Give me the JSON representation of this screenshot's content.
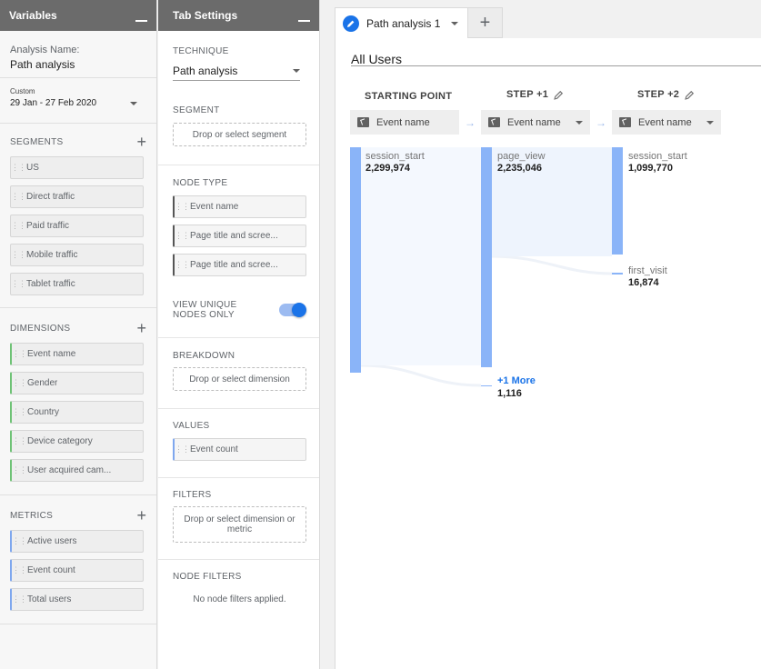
{
  "variables": {
    "title": "Variables",
    "analysis_name_label": "Analysis Name:",
    "analysis_name": "Path analysis",
    "date_preset": "Custom",
    "date_range": "29 Jan - 27 Feb 2020",
    "segments_title": "SEGMENTS",
    "segments": [
      "US",
      "Direct traffic",
      "Paid traffic",
      "Mobile traffic",
      "Tablet traffic"
    ],
    "dimensions_title": "DIMENSIONS",
    "dimensions": [
      "Event name",
      "Gender",
      "Country",
      "Device category",
      "User acquired cam..."
    ],
    "metrics_title": "METRICS",
    "metrics": [
      "Active users",
      "Event count",
      "Total users"
    ]
  },
  "settings": {
    "title": "Tab Settings",
    "technique_label": "TECHNIQUE",
    "technique_value": "Path analysis",
    "segment_label": "SEGMENT",
    "segment_drop": "Drop or select segment",
    "node_type_label": "NODE TYPE",
    "node_types": [
      "Event name",
      "Page title and scree...",
      "Page title and scree..."
    ],
    "unique_nodes_label": "VIEW UNIQUE NODES ONLY",
    "breakdown_label": "BREAKDOWN",
    "breakdown_drop": "Drop or select dimension",
    "values_label": "VALUES",
    "values_item": "Event count",
    "filters_label": "FILTERS",
    "filters_drop": "Drop or select dimension or metric",
    "node_filters_label": "NODE FILTERS",
    "node_filters_text": "No node filters applied."
  },
  "canvas": {
    "tab_label": "Path analysis 1",
    "add_tab": "+",
    "segment_title": "All Users",
    "columns": [
      {
        "header": "STARTING POINT",
        "node_type": "Event name"
      },
      {
        "header": "STEP +1",
        "node_type": "Event name"
      },
      {
        "header": "STEP +2",
        "node_type": "Event name"
      }
    ],
    "arrow": "→",
    "nodes": {
      "start_label": "session_start",
      "start_value": "2,299,974",
      "step1_label": "page_view",
      "step1_value": "2,235,046",
      "step1_more_label": "+1 More",
      "step1_more_value": "1,116",
      "step2_a_label": "session_start",
      "step2_a_value": "1,099,770",
      "step2_b_label": "first_visit",
      "step2_b_value": "16,874"
    }
  },
  "colors": {
    "accent": "#1a73e8",
    "bar": "#8ab4f8",
    "dimension": "#6fc276",
    "metric": "#7fa7ee"
  }
}
